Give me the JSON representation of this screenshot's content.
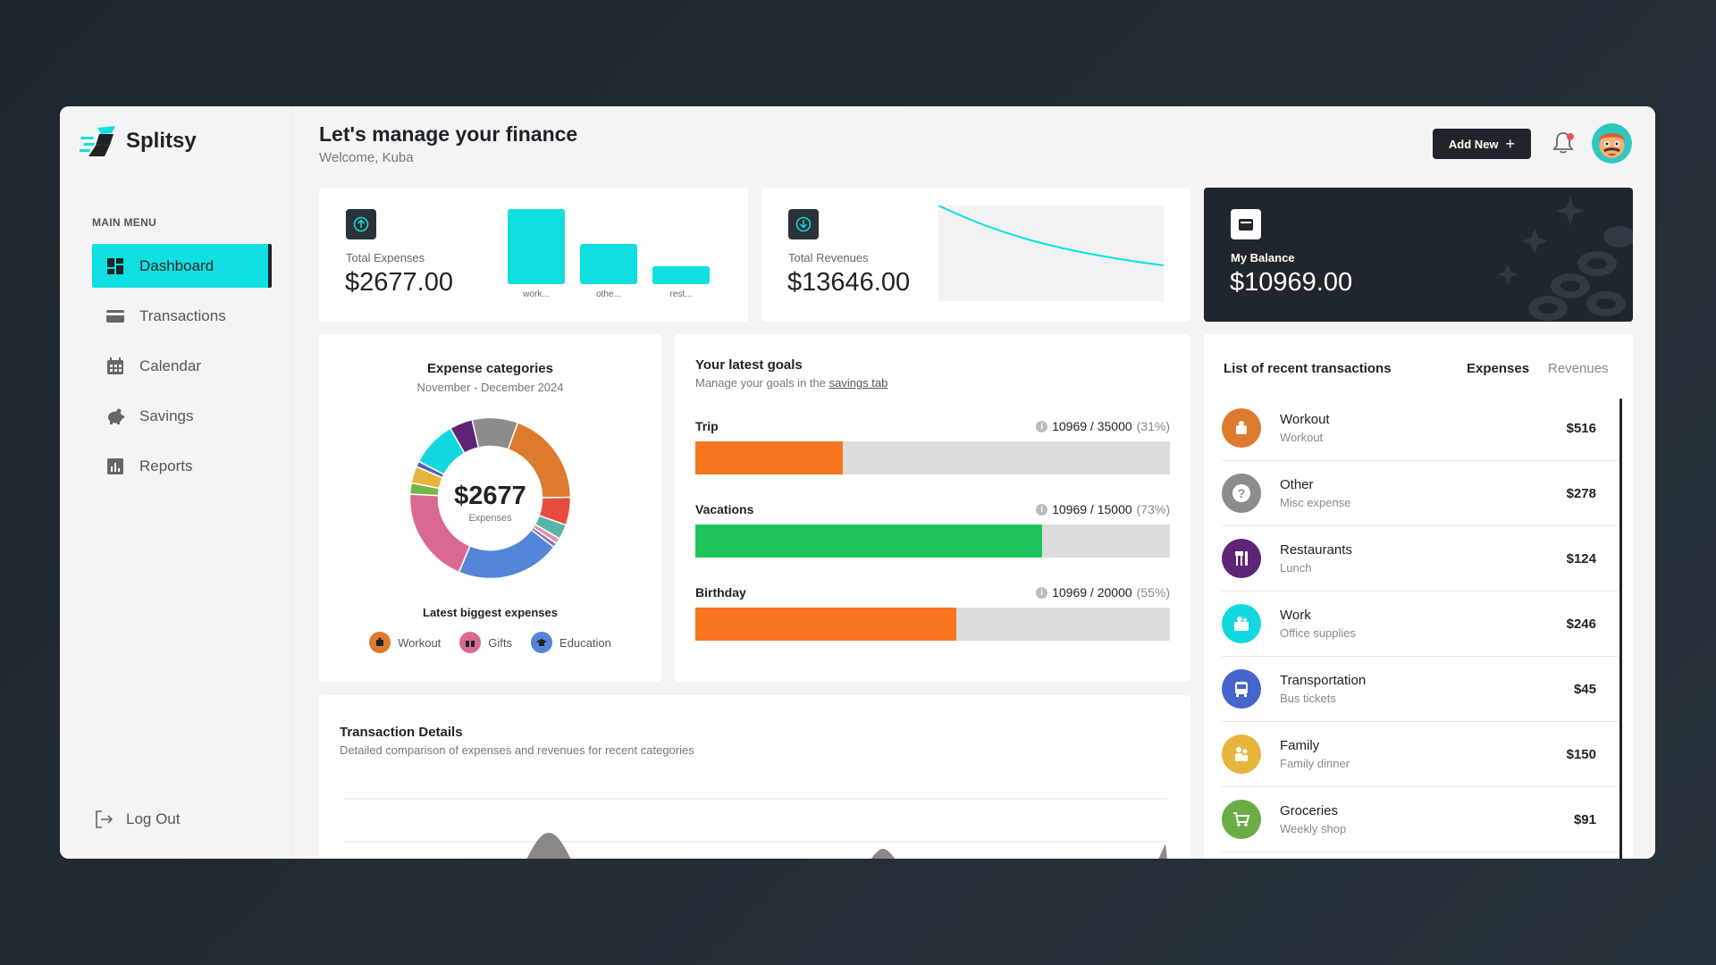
{
  "app": {
    "name": "Splitsy"
  },
  "sidebar": {
    "menu_title": "MAIN MENU",
    "items": [
      {
        "label": "Dashboard",
        "icon": "dashboard-icon",
        "active": true
      },
      {
        "label": "Transactions",
        "icon": "card-icon",
        "active": false
      },
      {
        "label": "Calendar",
        "icon": "calendar-icon",
        "active": false
      },
      {
        "label": "Savings",
        "icon": "piggy-bank-icon",
        "active": false
      },
      {
        "label": "Reports",
        "icon": "report-icon",
        "active": false
      }
    ],
    "logout": "Log Out"
  },
  "header": {
    "title": "Let's manage your finance",
    "subtitle": "Welcome, Kuba",
    "add_button": "Add New"
  },
  "stats": {
    "expenses": {
      "label": "Total Expenses",
      "value": "$2677.00",
      "bars": [
        {
          "label": "work...",
          "value": 100
        },
        {
          "label": "othe...",
          "value": 54
        },
        {
          "label": "rest...",
          "value": 24
        }
      ]
    },
    "revenues": {
      "label": "Total Revenues",
      "value": "$13646.00"
    },
    "balance": {
      "label": "My Balance",
      "value": "$10969.00"
    }
  },
  "expense_categories": {
    "title": "Expense categories",
    "period": "November - December 2024",
    "center_value": "$2677",
    "center_label": "Expenses",
    "slices": [
      {
        "value": 516,
        "color": "#dd7a2e"
      },
      {
        "value": 150,
        "color": "#e84c3d"
      },
      {
        "value": 80,
        "color": "#5ab3a8"
      },
      {
        "value": 30,
        "color": "#e88fa0"
      },
      {
        "value": 24,
        "color": "#8e73b8"
      },
      {
        "value": 560,
        "color": "#5585d8"
      },
      {
        "value": 520,
        "color": "#d96993"
      },
      {
        "value": 60,
        "color": "#73b64c"
      },
      {
        "value": 91,
        "color": "#e8b53c"
      },
      {
        "value": 30,
        "color": "#5560b4"
      },
      {
        "value": 246,
        "color": "#13d7de"
      },
      {
        "value": 124,
        "color": "#5e2576"
      },
      {
        "value": 246,
        "color": "#8c8c8c"
      }
    ],
    "biggest_title": "Latest biggest expenses",
    "biggest": [
      {
        "label": "Workout",
        "color": "#dd7a2e",
        "icon": "workout-icon"
      },
      {
        "label": "Gifts",
        "color": "#d96993",
        "icon": "gift-icon"
      },
      {
        "label": "Education",
        "color": "#5585d8",
        "icon": "education-icon"
      }
    ]
  },
  "goals": {
    "title": "Your latest goals",
    "subtitle_prefix": "Manage your goals in the",
    "subtitle_link": "savings tab",
    "items": [
      {
        "label": "Trip",
        "amount": "10969 / 35000",
        "pct": "(31%)",
        "progress": 0.31,
        "color": "#f7761f"
      },
      {
        "label": "Vacations",
        "amount": "10969 / 15000",
        "pct": "(73%)",
        "progress": 0.73,
        "color": "#21c35c"
      },
      {
        "label": "Birthday",
        "amount": "10969 / 20000",
        "pct": "(55%)",
        "progress": 0.55,
        "color": "#f7761f"
      }
    ]
  },
  "transaction_details": {
    "title": "Transaction Details",
    "subtitle": "Detailed comparison of expenses and revenues for recent categories"
  },
  "recent": {
    "title": "List of recent transactions",
    "tab_expenses": "Expenses",
    "tab_revenues": "Revenues",
    "items": [
      {
        "name": "Workout",
        "sub": "Workout",
        "amount": "$516",
        "color": "#dd7a2e",
        "icon": "workout-icon"
      },
      {
        "name": "Other",
        "sub": "Misc expense",
        "amount": "$278",
        "color": "#8c8c8c",
        "icon": "question-icon"
      },
      {
        "name": "Restaurants",
        "sub": "Lunch",
        "amount": "$124",
        "color": "#5e2576",
        "icon": "cutlery-icon"
      },
      {
        "name": "Work",
        "sub": "Office supplies",
        "amount": "$246",
        "color": "#13d7de",
        "icon": "work-icon"
      },
      {
        "name": "Transportation",
        "sub": "Bus tickets",
        "amount": "$45",
        "color": "#4466cc",
        "icon": "bus-icon"
      },
      {
        "name": "Family",
        "sub": "Family dinner",
        "amount": "$150",
        "color": "#e8b53c",
        "icon": "family-icon"
      },
      {
        "name": "Groceries",
        "sub": "Weekly shop",
        "amount": "$91",
        "color": "#6aad44",
        "icon": "cart-icon"
      }
    ]
  }
}
